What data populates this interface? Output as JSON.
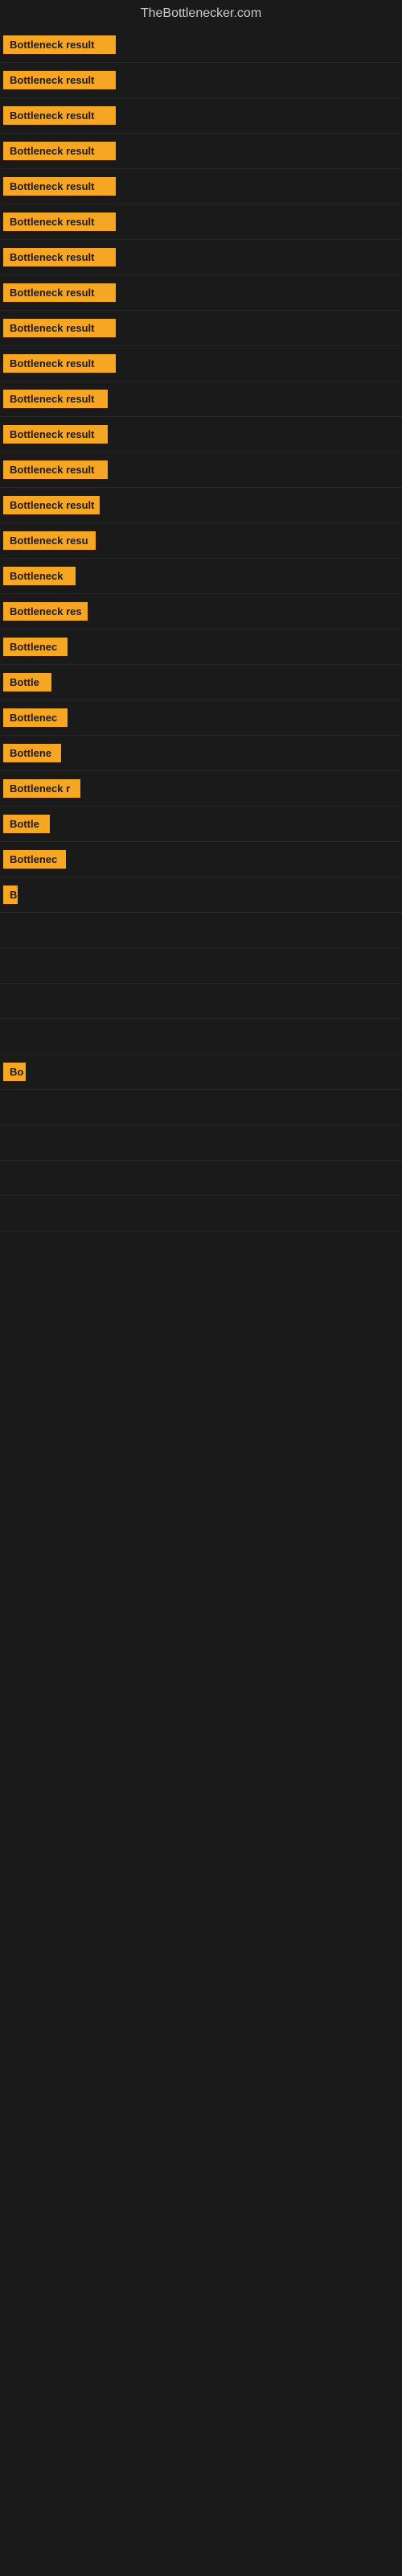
{
  "site": {
    "title": "TheBottlenecker.com"
  },
  "rows": [
    {
      "id": 1,
      "label": "Bottleneck result",
      "width": 140
    },
    {
      "id": 2,
      "label": "Bottleneck result",
      "width": 140
    },
    {
      "id": 3,
      "label": "Bottleneck result",
      "width": 140
    },
    {
      "id": 4,
      "label": "Bottleneck result",
      "width": 140
    },
    {
      "id": 5,
      "label": "Bottleneck result",
      "width": 140
    },
    {
      "id": 6,
      "label": "Bottleneck result",
      "width": 140
    },
    {
      "id": 7,
      "label": "Bottleneck result",
      "width": 140
    },
    {
      "id": 8,
      "label": "Bottleneck result",
      "width": 140
    },
    {
      "id": 9,
      "label": "Bottleneck result",
      "width": 140
    },
    {
      "id": 10,
      "label": "Bottleneck result",
      "width": 140
    },
    {
      "id": 11,
      "label": "Bottleneck result",
      "width": 130
    },
    {
      "id": 12,
      "label": "Bottleneck result",
      "width": 130
    },
    {
      "id": 13,
      "label": "Bottleneck result",
      "width": 130
    },
    {
      "id": 14,
      "label": "Bottleneck result",
      "width": 120
    },
    {
      "id": 15,
      "label": "Bottleneck resu",
      "width": 115
    },
    {
      "id": 16,
      "label": "Bottleneck",
      "width": 90
    },
    {
      "id": 17,
      "label": "Bottleneck res",
      "width": 105
    },
    {
      "id": 18,
      "label": "Bottlenec",
      "width": 80
    },
    {
      "id": 19,
      "label": "Bottle",
      "width": 60
    },
    {
      "id": 20,
      "label": "Bottlenec",
      "width": 80
    },
    {
      "id": 21,
      "label": "Bottlene",
      "width": 72
    },
    {
      "id": 22,
      "label": "Bottleneck r",
      "width": 96
    },
    {
      "id": 23,
      "label": "Bottle",
      "width": 58
    },
    {
      "id": 24,
      "label": "Bottlenec",
      "width": 78
    },
    {
      "id": 25,
      "label": "B",
      "width": 18
    },
    {
      "id": 26,
      "label": "",
      "width": 0
    },
    {
      "id": 27,
      "label": "",
      "width": 0
    },
    {
      "id": 28,
      "label": "",
      "width": 0
    },
    {
      "id": 29,
      "label": "",
      "width": 0
    },
    {
      "id": 30,
      "label": "Bo",
      "width": 28
    },
    {
      "id": 31,
      "label": "",
      "width": 0
    },
    {
      "id": 32,
      "label": "",
      "width": 0
    },
    {
      "id": 33,
      "label": "",
      "width": 0
    },
    {
      "id": 34,
      "label": "",
      "width": 0
    }
  ]
}
